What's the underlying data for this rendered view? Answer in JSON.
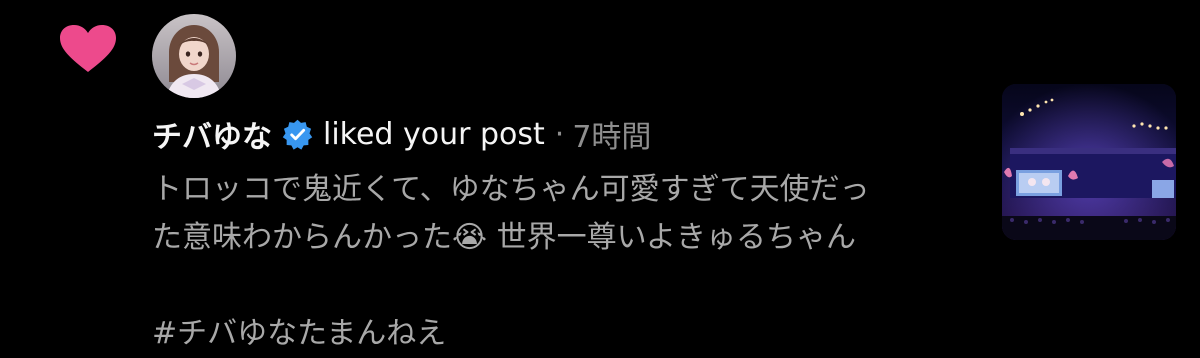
{
  "notification": {
    "type_icon": "heart-icon",
    "type_color": "#ed4a8c",
    "avatar_icon": "user-avatar",
    "username": "チバゆな",
    "verified_icon": "verified-badge-icon",
    "verified_color": "#3897f0",
    "action_text": "liked your post",
    "separator": "·",
    "time_ago": "7時間",
    "comment_text": "トロッコで鬼近くて、ゆなちゃん可愛すぎて天使だった意味わからんかった😭 世界一尊いよきゅるちゃん",
    "comment_line1": "トロッコで鬼近くて、ゆなちゃん可愛すぎて天使だっ",
    "comment_line2": "た意味わからんかった😭 世界一尊いよきゅるちゃん",
    "hashtag": "#チバゆなたまんねえ",
    "thumbnail": "post-thumbnail-concert"
  }
}
